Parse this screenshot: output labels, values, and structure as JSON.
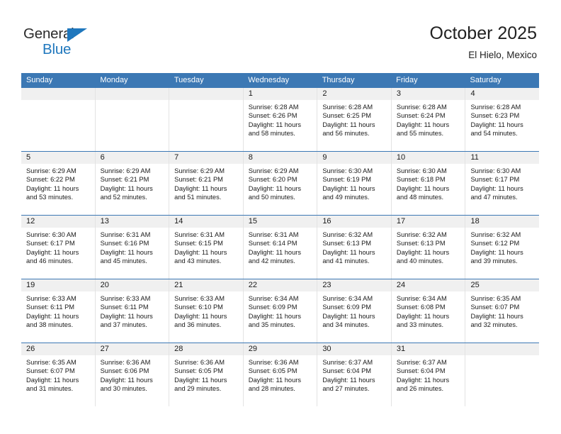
{
  "logo": {
    "word1": "General",
    "word2": "Blue",
    "triangle_color": "#1f77bd",
    "text_color": "#2b2b2b"
  },
  "header": {
    "title": "October 2025",
    "subtitle": "El Hielo, Mexico"
  },
  "theme": {
    "header_bg": "#3c78b4",
    "header_text": "#ffffff",
    "daynum_band": "#f0f0f0",
    "cell_border": "#e3e3e3",
    "row_border": "#3c78b4"
  },
  "weekdays": [
    "Sunday",
    "Monday",
    "Tuesday",
    "Wednesday",
    "Thursday",
    "Friday",
    "Saturday"
  ],
  "weeks": [
    [
      {
        "empty": true
      },
      {
        "empty": true
      },
      {
        "empty": true
      },
      {
        "day": "1",
        "sunrise": "Sunrise: 6:28 AM",
        "sunset": "Sunset: 6:26 PM",
        "daylight1": "Daylight: 11 hours",
        "daylight2": "and 58 minutes."
      },
      {
        "day": "2",
        "sunrise": "Sunrise: 6:28 AM",
        "sunset": "Sunset: 6:25 PM",
        "daylight1": "Daylight: 11 hours",
        "daylight2": "and 56 minutes."
      },
      {
        "day": "3",
        "sunrise": "Sunrise: 6:28 AM",
        "sunset": "Sunset: 6:24 PM",
        "daylight1": "Daylight: 11 hours",
        "daylight2": "and 55 minutes."
      },
      {
        "day": "4",
        "sunrise": "Sunrise: 6:28 AM",
        "sunset": "Sunset: 6:23 PM",
        "daylight1": "Daylight: 11 hours",
        "daylight2": "and 54 minutes."
      }
    ],
    [
      {
        "day": "5",
        "sunrise": "Sunrise: 6:29 AM",
        "sunset": "Sunset: 6:22 PM",
        "daylight1": "Daylight: 11 hours",
        "daylight2": "and 53 minutes."
      },
      {
        "day": "6",
        "sunrise": "Sunrise: 6:29 AM",
        "sunset": "Sunset: 6:21 PM",
        "daylight1": "Daylight: 11 hours",
        "daylight2": "and 52 minutes."
      },
      {
        "day": "7",
        "sunrise": "Sunrise: 6:29 AM",
        "sunset": "Sunset: 6:21 PM",
        "daylight1": "Daylight: 11 hours",
        "daylight2": "and 51 minutes."
      },
      {
        "day": "8",
        "sunrise": "Sunrise: 6:29 AM",
        "sunset": "Sunset: 6:20 PM",
        "daylight1": "Daylight: 11 hours",
        "daylight2": "and 50 minutes."
      },
      {
        "day": "9",
        "sunrise": "Sunrise: 6:30 AM",
        "sunset": "Sunset: 6:19 PM",
        "daylight1": "Daylight: 11 hours",
        "daylight2": "and 49 minutes."
      },
      {
        "day": "10",
        "sunrise": "Sunrise: 6:30 AM",
        "sunset": "Sunset: 6:18 PM",
        "daylight1": "Daylight: 11 hours",
        "daylight2": "and 48 minutes."
      },
      {
        "day": "11",
        "sunrise": "Sunrise: 6:30 AM",
        "sunset": "Sunset: 6:17 PM",
        "daylight1": "Daylight: 11 hours",
        "daylight2": "and 47 minutes."
      }
    ],
    [
      {
        "day": "12",
        "sunrise": "Sunrise: 6:30 AM",
        "sunset": "Sunset: 6:17 PM",
        "daylight1": "Daylight: 11 hours",
        "daylight2": "and 46 minutes."
      },
      {
        "day": "13",
        "sunrise": "Sunrise: 6:31 AM",
        "sunset": "Sunset: 6:16 PM",
        "daylight1": "Daylight: 11 hours",
        "daylight2": "and 45 minutes."
      },
      {
        "day": "14",
        "sunrise": "Sunrise: 6:31 AM",
        "sunset": "Sunset: 6:15 PM",
        "daylight1": "Daylight: 11 hours",
        "daylight2": "and 43 minutes."
      },
      {
        "day": "15",
        "sunrise": "Sunrise: 6:31 AM",
        "sunset": "Sunset: 6:14 PM",
        "daylight1": "Daylight: 11 hours",
        "daylight2": "and 42 minutes."
      },
      {
        "day": "16",
        "sunrise": "Sunrise: 6:32 AM",
        "sunset": "Sunset: 6:13 PM",
        "daylight1": "Daylight: 11 hours",
        "daylight2": "and 41 minutes."
      },
      {
        "day": "17",
        "sunrise": "Sunrise: 6:32 AM",
        "sunset": "Sunset: 6:13 PM",
        "daylight1": "Daylight: 11 hours",
        "daylight2": "and 40 minutes."
      },
      {
        "day": "18",
        "sunrise": "Sunrise: 6:32 AM",
        "sunset": "Sunset: 6:12 PM",
        "daylight1": "Daylight: 11 hours",
        "daylight2": "and 39 minutes."
      }
    ],
    [
      {
        "day": "19",
        "sunrise": "Sunrise: 6:33 AM",
        "sunset": "Sunset: 6:11 PM",
        "daylight1": "Daylight: 11 hours",
        "daylight2": "and 38 minutes."
      },
      {
        "day": "20",
        "sunrise": "Sunrise: 6:33 AM",
        "sunset": "Sunset: 6:11 PM",
        "daylight1": "Daylight: 11 hours",
        "daylight2": "and 37 minutes."
      },
      {
        "day": "21",
        "sunrise": "Sunrise: 6:33 AM",
        "sunset": "Sunset: 6:10 PM",
        "daylight1": "Daylight: 11 hours",
        "daylight2": "and 36 minutes."
      },
      {
        "day": "22",
        "sunrise": "Sunrise: 6:34 AM",
        "sunset": "Sunset: 6:09 PM",
        "daylight1": "Daylight: 11 hours",
        "daylight2": "and 35 minutes."
      },
      {
        "day": "23",
        "sunrise": "Sunrise: 6:34 AM",
        "sunset": "Sunset: 6:09 PM",
        "daylight1": "Daylight: 11 hours",
        "daylight2": "and 34 minutes."
      },
      {
        "day": "24",
        "sunrise": "Sunrise: 6:34 AM",
        "sunset": "Sunset: 6:08 PM",
        "daylight1": "Daylight: 11 hours",
        "daylight2": "and 33 minutes."
      },
      {
        "day": "25",
        "sunrise": "Sunrise: 6:35 AM",
        "sunset": "Sunset: 6:07 PM",
        "daylight1": "Daylight: 11 hours",
        "daylight2": "and 32 minutes."
      }
    ],
    [
      {
        "day": "26",
        "sunrise": "Sunrise: 6:35 AM",
        "sunset": "Sunset: 6:07 PM",
        "daylight1": "Daylight: 11 hours",
        "daylight2": "and 31 minutes."
      },
      {
        "day": "27",
        "sunrise": "Sunrise: 6:36 AM",
        "sunset": "Sunset: 6:06 PM",
        "daylight1": "Daylight: 11 hours",
        "daylight2": "and 30 minutes."
      },
      {
        "day": "28",
        "sunrise": "Sunrise: 6:36 AM",
        "sunset": "Sunset: 6:05 PM",
        "daylight1": "Daylight: 11 hours",
        "daylight2": "and 29 minutes."
      },
      {
        "day": "29",
        "sunrise": "Sunrise: 6:36 AM",
        "sunset": "Sunset: 6:05 PM",
        "daylight1": "Daylight: 11 hours",
        "daylight2": "and 28 minutes."
      },
      {
        "day": "30",
        "sunrise": "Sunrise: 6:37 AM",
        "sunset": "Sunset: 6:04 PM",
        "daylight1": "Daylight: 11 hours",
        "daylight2": "and 27 minutes."
      },
      {
        "day": "31",
        "sunrise": "Sunrise: 6:37 AM",
        "sunset": "Sunset: 6:04 PM",
        "daylight1": "Daylight: 11 hours",
        "daylight2": "and 26 minutes."
      },
      {
        "empty": true
      }
    ]
  ]
}
